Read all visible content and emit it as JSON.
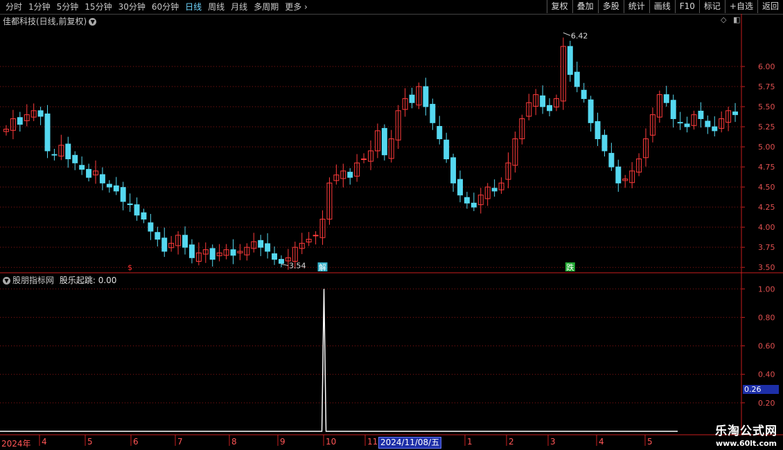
{
  "toolbar": {
    "periods": [
      "分时",
      "1分钟",
      "5分钟",
      "15分钟",
      "30分钟",
      "60分钟",
      "日线",
      "周线",
      "月线",
      "多周期",
      "更多"
    ],
    "active_period": "日线",
    "actions": [
      "复权",
      "叠加",
      "多股",
      "统计",
      "画线",
      "F10",
      "标记",
      "+自选",
      "返回"
    ]
  },
  "main_panel": {
    "title": "佳都科技(日线,前复权)",
    "high_marker": "6.42",
    "low_marker": "3.54",
    "price_ticks": [
      "6.00",
      "5.75",
      "5.50",
      "5.25",
      "5.00",
      "4.75",
      "4.50",
      "4.25",
      "4.00",
      "3.75",
      "3.50"
    ],
    "signals": [
      {
        "label": "$",
        "color": "#ff3030"
      },
      {
        "label": "解",
        "color": "#33b0c8"
      },
      {
        "label": "跌",
        "color": "#22aa33"
      }
    ]
  },
  "indicator_panel": {
    "title": "股朋指标网",
    "series_label": "股乐起跳:",
    "series_value": "0.00",
    "ticks": [
      "1.00",
      "0.80",
      "0.60",
      "0.40",
      "0.20"
    ],
    "cursor_value": "0.26"
  },
  "time_axis": {
    "year_label": "2024年",
    "months": [
      "4",
      "5",
      "6",
      "7",
      "8",
      "9",
      "10",
      "11",
      "1",
      "2",
      "3",
      "4",
      "5"
    ],
    "selected_date": "2024/11/08/五"
  },
  "watermark": {
    "line1": "乐淘公式网",
    "line2": "www.60lt.com"
  },
  "colors": {
    "up": "#ff3b3b",
    "down": "#55d8f0",
    "grid": "#8b1515",
    "axis": "#c81e1e",
    "text": "#c8c8c8",
    "indicator": "#ffffff"
  },
  "chart_data": {
    "type": "candlestick",
    "title": "佳都科技(日线,前复权)",
    "ylim": [
      3.45,
      6.5
    ],
    "close_sample": [
      5.22,
      5.35,
      5.28,
      5.4,
      5.45,
      5.38,
      4.95,
      4.9,
      5.02,
      4.85,
      4.8,
      4.72,
      4.62,
      4.7,
      4.55,
      4.5,
      4.45,
      4.32,
      4.28,
      4.15,
      4.1,
      3.95,
      3.85,
      3.7,
      3.8,
      3.9,
      3.75,
      3.62,
      3.68,
      3.72,
      3.6,
      3.68,
      3.72,
      3.65,
      3.7,
      3.75,
      3.82,
      3.75,
      3.7,
      3.6,
      3.55,
      3.62,
      3.75,
      3.8,
      3.85,
      3.9,
      4.1,
      4.55,
      4.65,
      4.7,
      4.62,
      4.8,
      4.85,
      4.95,
      5.2,
      4.9,
      5.1,
      5.45,
      5.6,
      5.55,
      5.75,
      5.5,
      5.3,
      5.1,
      4.85,
      4.55,
      4.4,
      4.3,
      4.25,
      4.4,
      4.5,
      4.45,
      4.55,
      4.8,
      5.1,
      5.35,
      5.55,
      5.65,
      5.5,
      5.45,
      5.6,
      6.25,
      5.9,
      5.75,
      5.6,
      5.3,
      5.1,
      4.95,
      4.75,
      4.55,
      4.6,
      4.7,
      4.85,
      5.1,
      5.4,
      5.65,
      5.55,
      5.35,
      5.3,
      5.25,
      5.4,
      5.35,
      5.25,
      5.2,
      5.35,
      5.45,
      5.4
    ],
    "high": 6.42,
    "low": 3.54,
    "indicator": {
      "name": "股乐起跳",
      "ylim": [
        0,
        1.05
      ],
      "values_note_index": 46,
      "peak_value": 1.0,
      "baseline_value": 0.0
    }
  }
}
